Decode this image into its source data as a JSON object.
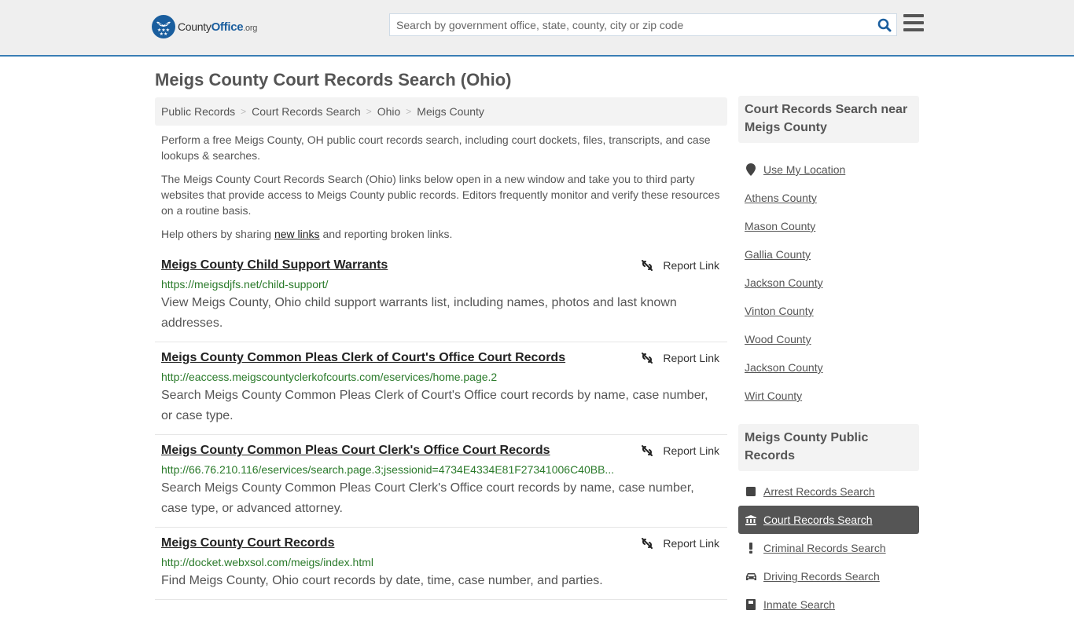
{
  "header": {
    "logo": {
      "county": "County",
      "office": "Office",
      "org": ".org"
    },
    "search_placeholder": "Search by government office, state, county, city or zip code",
    "search_value": ""
  },
  "page_title": "Meigs County Court Records Search (Ohio)",
  "breadcrumb": [
    "Public Records",
    "Court Records Search",
    "Ohio",
    "Meigs County"
  ],
  "intro": {
    "p1": "Perform a free Meigs County, OH public court records search, including court dockets, files, transcripts, and case lookups & searches.",
    "p2": "The Meigs County Court Records Search (Ohio) links below open in a new window and take you to third party websites that provide access to Meigs County public records. Editors frequently monitor and verify these resources on a routine basis.",
    "p3_before": "Help others by sharing ",
    "p3_link": "new links",
    "p3_after": " and reporting broken links."
  },
  "report_label": "Report Link",
  "results": [
    {
      "title": "Meigs County Child Support Warrants",
      "url": "https://meigsdjfs.net/child-support/",
      "description": "View Meigs County, Ohio child support warrants list, including names, photos and last known addresses."
    },
    {
      "title": "Meigs County Common Pleas Clerk of Court's Office Court Records",
      "url": "http://eaccess.meigscountyclerkofcourts.com/eservices/home.page.2",
      "description": "Search Meigs County Common Pleas Clerk of Court's Office court records by name, case number, or case type."
    },
    {
      "title": "Meigs County Common Pleas Court Clerk's Office Court Records",
      "url": "http://66.76.210.116/eservices/search.page.3;jsessionid=4734E4334E81F27341006C40BB...",
      "description": "Search Meigs County Common Pleas Court Clerk's Office court records by name, case number, case type, or advanced attorney."
    },
    {
      "title": "Meigs County Court Records",
      "url": "http://docket.webxsol.com/meigs/index.html",
      "description": "Find Meigs County, Ohio court records by date, time, case number, and parties."
    }
  ],
  "sidebar": {
    "nearby_heading": "Court Records Search near Meigs County",
    "use_location": "Use My Location",
    "nearby": [
      "Athens County",
      "Mason County",
      "Gallia County",
      "Jackson County",
      "Vinton County",
      "Wood County",
      "Jackson County",
      "Wirt County"
    ],
    "public_heading": "Meigs County Public Records",
    "public_links": [
      {
        "label": "Arrest Records Search",
        "icon": "square-icon",
        "active": false
      },
      {
        "label": "Court Records Search",
        "icon": "courthouse-icon",
        "active": true
      },
      {
        "label": "Criminal Records Search",
        "icon": "exclamation-icon",
        "active": false
      },
      {
        "label": "Driving Records Search",
        "icon": "car-icon",
        "active": false
      },
      {
        "label": "Inmate Search",
        "icon": "jail-icon",
        "active": false
      }
    ]
  }
}
